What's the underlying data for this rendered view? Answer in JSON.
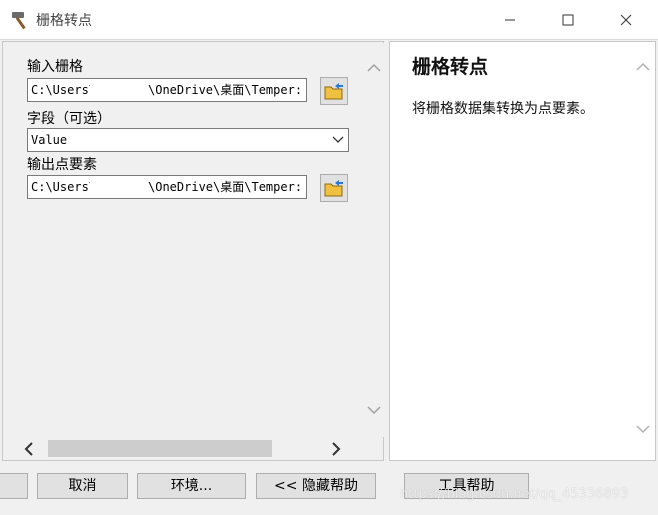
{
  "window": {
    "title": "栅格转点"
  },
  "form": {
    "input_raster": {
      "label": "输入栅格",
      "value_start": "C:\\Users\\",
      "value_end": "\\OneDrive\\桌面\\Temper:"
    },
    "field": {
      "label": "字段（可选）",
      "value": "Value"
    },
    "output_points": {
      "label": "输出点要素",
      "value_start": "C:\\Users\\",
      "value_end": "\\OneDrive\\桌面\\Temper:"
    }
  },
  "help": {
    "title": "栅格转点",
    "description": "将栅格数据集转换为点要素。"
  },
  "buttons": {
    "cancel": "取消",
    "environments": "环境...",
    "hide_help": "<< 隐藏帮助",
    "tool_help": "工具帮助"
  },
  "watermark": "https://blog.csdn.net/qq_45336893",
  "colors": {
    "window_bg": "#f0f0f0",
    "button_bg": "#e1e1e1",
    "folder_icon": "#f0c040"
  }
}
